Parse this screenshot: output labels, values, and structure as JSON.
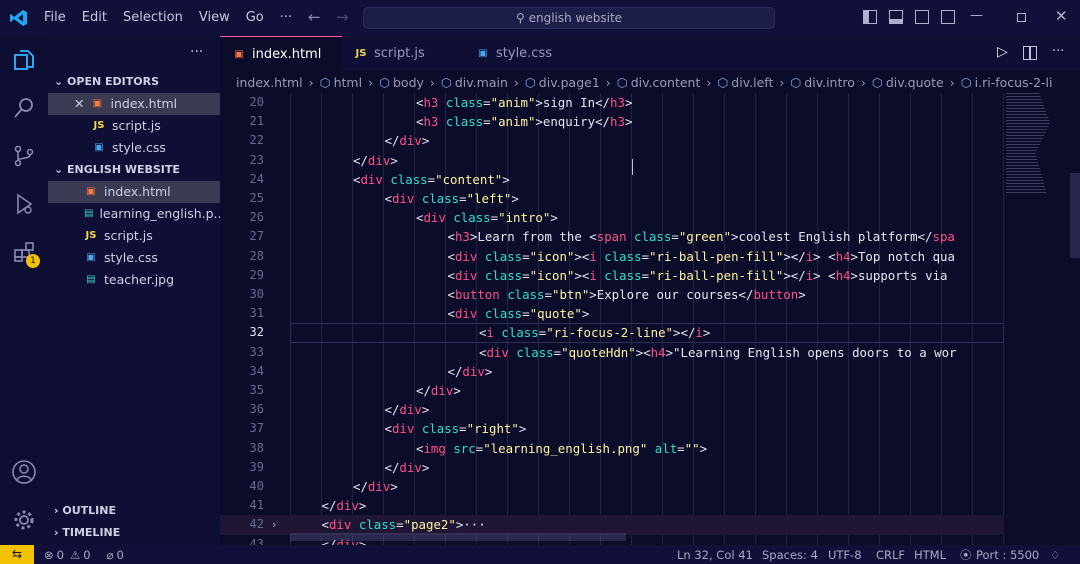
{
  "titlebar": {
    "menu": [
      "File",
      "Edit",
      "Selection",
      "View",
      "Go",
      "···"
    ],
    "search": "english website"
  },
  "sidebar": {
    "open_editors_title": "OPEN EDITORS",
    "open_editors": [
      {
        "name": "index.html",
        "type": "html"
      },
      {
        "name": "script.js",
        "type": "js"
      },
      {
        "name": "style.css",
        "type": "css"
      }
    ],
    "project_title": "ENGLISH WEBSITE",
    "files": [
      {
        "name": "index.html",
        "type": "html"
      },
      {
        "name": "learning_english.p...",
        "type": "img"
      },
      {
        "name": "script.js",
        "type": "js"
      },
      {
        "name": "style.css",
        "type": "css"
      },
      {
        "name": "teacher.jpg",
        "type": "img"
      }
    ],
    "outline": "OUTLINE",
    "timeline": "TIMELINE",
    "ext_badge": "1"
  },
  "tabs": [
    {
      "name": "index.html",
      "type": "html"
    },
    {
      "name": "script.js",
      "type": "js"
    },
    {
      "name": "style.css",
      "type": "css"
    }
  ],
  "breadcrumb": [
    "index.html",
    "html",
    "body",
    "div.main",
    "div.page1",
    "div.content",
    "div.left",
    "div.intro",
    "div.quote",
    "i.ri-focus-2-li"
  ],
  "editor": {
    "line_numbers": [
      "20",
      "21",
      "22",
      "23",
      "24",
      "25",
      "26",
      "27",
      "28",
      "29",
      "30",
      "31",
      "32",
      "33",
      "34",
      "35",
      "36",
      "37",
      "38",
      "39",
      "40",
      "41",
      "42",
      "43"
    ],
    "lines": [
      "<h3 class=\"anim\">sign In</h3>",
      "<h3 class=\"anim\">enquiry</h3>",
      "</div>",
      "</div>",
      "<div class=\"content\">",
      "<div class=\"left\">",
      "<div class=\"intro\">",
      "<h3>Learn from the <span class=\"green\">coolest English platform</spa",
      "<div class=\"icon\"><i class=\"ri-ball-pen-fill\"></i> <h4>Top notch qua",
      "<div class=\"icon\"><i class=\"ri-ball-pen-fill\"></i> <h4>supports via",
      "<button class=\"btn\">Explore our courses</button>",
      "<div class=\"quote\">",
      "<i class=\"ri-focus-2-line\"></i>",
      "<div class=\"quoteHdn\"><h4>\"Learning English opens doors to a wor",
      "</div>",
      "</div>",
      "</div>",
      "<div class=\"right\">",
      "<img src=\"learning_english.png\" alt=\"\">",
      "</div>",
      "</div>",
      "</div>",
      "<div class=\"page2\">···",
      "</div>"
    ],
    "indent": [
      4,
      4,
      3,
      2,
      2,
      3,
      4,
      5,
      5,
      5,
      5,
      5,
      6,
      6,
      5,
      4,
      3,
      3,
      4,
      3,
      2,
      1,
      1,
      1
    ]
  },
  "statusbar": {
    "errors": "0",
    "warnings": "0",
    "ports": "0",
    "position": "Ln 32, Col 41",
    "spaces": "Spaces: 4",
    "encoding": "UTF-8",
    "eol": "CRLF",
    "language": "HTML",
    "port": "Port : 5500"
  },
  "colors": {
    "tag": "#ff4f8a",
    "attr": "#2fe0c8",
    "string": "#fff5a0",
    "accent": "#ff5a9a"
  }
}
